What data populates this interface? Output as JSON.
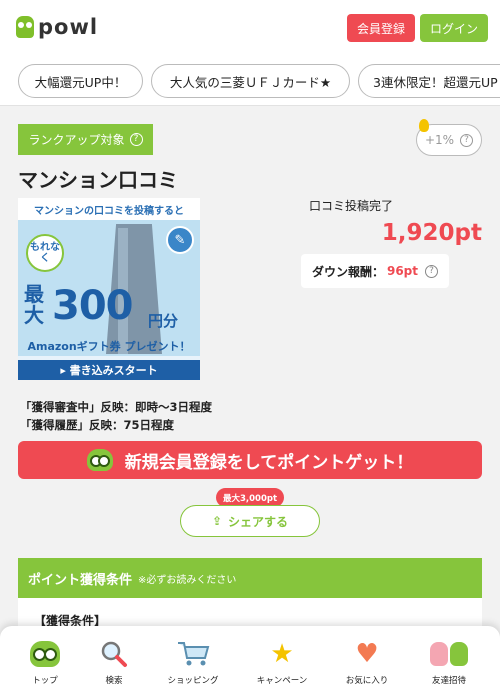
{
  "header": {
    "logo_text": "powl",
    "register_label": "会員登録",
    "login_label": "ログイン"
  },
  "chips": [
    {
      "label": "大幅還元UP中！"
    },
    {
      "label": "大人気の三菱ＵＦＪカード★"
    },
    {
      "label": "3連休限定！超還元UP"
    }
  ],
  "offer": {
    "rank_badge": "ランクアップ対象",
    "percent_label": "+1%",
    "title": "マンション口コミ",
    "status_label": "口コミ投稿完了",
    "points": "1,920pt",
    "down_label": "ダウン報酬：",
    "down_value": "96pt",
    "notes": [
      "「獲得審査中」反映：即時〜3日程度",
      "「獲得履歴」反映：75日程度"
    ]
  },
  "banner": {
    "top_text": "マンションの口コミを投稿すると",
    "badge_text": "もれなく",
    "prefix": "最大",
    "amount": "300",
    "unit": "円分",
    "gift_text": "Amazonギフト券 プレゼント！",
    "cta_text": "▸ 書き込みスタート"
  },
  "cta": {
    "label": "新規会員登録をしてポイントゲット！"
  },
  "share": {
    "badge": "最大3,000pt",
    "label": "シェアする"
  },
  "conditions": {
    "title": "ポイント獲得条件",
    "subtitle": "※必ずお読みください",
    "label": "【獲得条件】"
  },
  "bottom_nav": [
    {
      "label": "トップ",
      "icon": "owl-icon"
    },
    {
      "label": "検索",
      "icon": "search-icon"
    },
    {
      "label": "ショッピング",
      "icon": "cart-icon"
    },
    {
      "label": "キャンペーン",
      "icon": "star-icon"
    },
    {
      "label": "お気に入り",
      "icon": "heart-icon"
    },
    {
      "label": "友達招待",
      "icon": "friends-icon"
    }
  ],
  "colors": {
    "brand_green": "#86c53c",
    "accent_red": "#ef4a52",
    "banner_blue": "#1e5fa6"
  }
}
